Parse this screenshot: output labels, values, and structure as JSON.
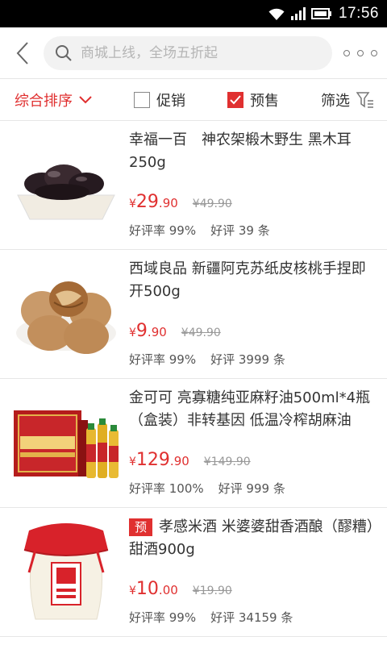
{
  "status": {
    "time": "17:56"
  },
  "search": {
    "placeholder": "商城上线，全场五折起"
  },
  "filters": {
    "sort_label": "综合排序",
    "promo_label": "促销",
    "presale_label": "预售",
    "filter_label": "筛选"
  },
  "products": [
    {
      "title": "幸福一百　神农架椴木野生 黑木耳250g",
      "tag": "",
      "price_int": "29",
      "price_dec": ".90",
      "orig": "¥49.90",
      "rate_label": "好评率 99%",
      "reviews_label": "好评 39 条",
      "thumb": "black-fungus-image"
    },
    {
      "title": "西域良品 新疆阿克苏纸皮核桃手捏即开500g",
      "tag": "",
      "price_int": "9",
      "price_dec": ".90",
      "orig": "¥49.90",
      "rate_label": "好评率 99%",
      "reviews_label": "好评 3999 条",
      "thumb": "walnut-image"
    },
    {
      "title": "金可可 亮寡糖纯亚麻籽油500ml*4瓶（盒装）非转基因 低温冷榨胡麻油",
      "tag": "",
      "price_int": "129",
      "price_dec": ".90",
      "orig": "¥149.90",
      "rate_label": "好评率 100%",
      "reviews_label": "好评 999 条",
      "thumb": "oil-gift-box-image"
    },
    {
      "title": "孝感米酒 米婆婆甜香酒酿（醪糟）甜酒900g",
      "tag": "预",
      "price_int": "10",
      "price_dec": ".00",
      "orig": "¥19.90",
      "rate_label": "好评率 99%",
      "reviews_label": "好评 34159 条",
      "thumb": "rice-wine-jar-image"
    }
  ],
  "colors": {
    "accent": "#e03030"
  }
}
